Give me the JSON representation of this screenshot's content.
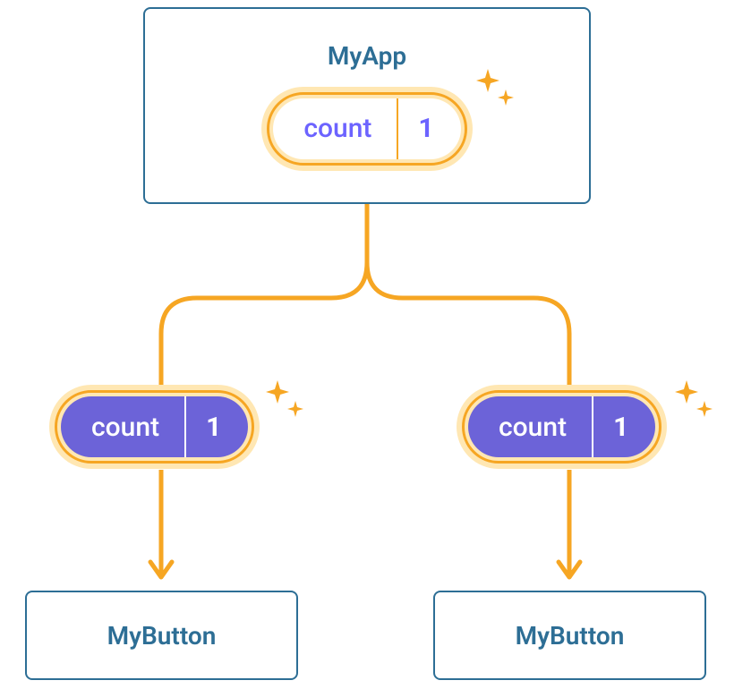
{
  "parent": {
    "title": "MyApp",
    "pill": {
      "label": "count",
      "value": "1"
    }
  },
  "props": {
    "left": {
      "label": "count",
      "value": "1"
    },
    "right": {
      "label": "count",
      "value": "1"
    }
  },
  "children": {
    "left": {
      "title": "MyButton"
    },
    "right": {
      "title": "MyButton"
    }
  },
  "colors": {
    "frame": "#2d6e95",
    "connector": "#f6a623",
    "glow": "#ffe7b3",
    "pillLightText": "#6c63ff",
    "pillDarkFill": "#6c63d8"
  }
}
